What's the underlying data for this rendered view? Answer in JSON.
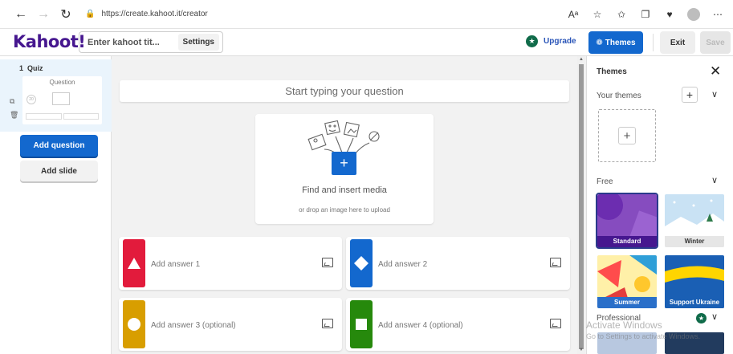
{
  "browser": {
    "url": "https://create.kahoot.it/creator"
  },
  "header": {
    "logo": "Kahoot!",
    "title_placeholder": "Enter kahoot tit...",
    "settings_label": "Settings",
    "upgrade_label": "Upgrade",
    "themes_label": "Themes",
    "exit_label": "Exit",
    "save_label": "Save"
  },
  "sidebar": {
    "slide_number": "1",
    "slide_type": "Quiz",
    "thumb_label": "Question",
    "add_question_label": "Add question",
    "add_slide_label": "Add slide"
  },
  "editor": {
    "question_placeholder": "Start typing your question",
    "media_title": "Find and insert media",
    "media_subtitle": "or drop an image here to upload",
    "answers": [
      {
        "label": "Add answer 1",
        "color": "#e21b3c",
        "shape": "triangle"
      },
      {
        "label": "Add answer 2",
        "color": "#1368ce",
        "shape": "diamond"
      },
      {
        "label": "Add answer 3 (optional)",
        "color": "#d89e00",
        "shape": "circle"
      },
      {
        "label": "Add answer 4 (optional)",
        "color": "#26890c",
        "shape": "square"
      }
    ]
  },
  "themes_panel": {
    "title": "Themes",
    "your_themes": "Your themes",
    "free": "Free",
    "professional": "Professional",
    "tiles": {
      "standard": "Standard",
      "winter": "Winter",
      "summer": "Summer",
      "ukraine": "Support Ukraine"
    }
  },
  "watermark": {
    "line1": "Activate Windows",
    "line2": "Go to Settings to activate Windows."
  },
  "colors": {
    "brand": "#46178f",
    "primary": "#1368ce"
  }
}
